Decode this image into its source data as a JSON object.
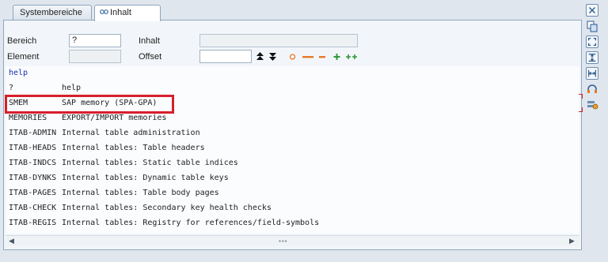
{
  "tabs": {
    "systembereiche": "Systembereiche",
    "inhalt": "Inhalt"
  },
  "form": {
    "bereich_label": "Bereich",
    "bereich_value": "?",
    "inhalt_label": "Inhalt",
    "inhalt_value": "",
    "element_label": "Element",
    "element_value": "",
    "offset_label": "Offset",
    "offset_value": ""
  },
  "output": {
    "header": "help",
    "rows": [
      {
        "key": "?",
        "desc": "help"
      },
      {
        "key": "SMEM",
        "desc": "SAP memory (SPA-GPA)"
      },
      {
        "key": "MEMORIES",
        "desc": "EXPORT/IMPORT memories"
      },
      {
        "key": "ITAB-ADMIN",
        "desc": "Internal table administration"
      },
      {
        "key": "ITAB-HEADS",
        "desc": "Internal tables: Table headers"
      },
      {
        "key": "ITAB-INDCS",
        "desc": "Internal tables: Static table indices"
      },
      {
        "key": "ITAB-DYNKS",
        "desc": "Internal tables: Dynamic table keys"
      },
      {
        "key": "ITAB-PAGES",
        "desc": "Internal tables: Table body pages"
      },
      {
        "key": "ITAB-CHECK",
        "desc": "Internal tables: Secondary key health checks"
      },
      {
        "key": "ITAB-REGIS",
        "desc": "Internal tables: Registry for references/field-symbols"
      }
    ]
  },
  "toolbar_icons": [
    "double-arrow-up-icon",
    "double-arrow-down-icon",
    "circle-icon",
    "long-minus-icon",
    "short-minus-icon",
    "plus-icon",
    "double-plus-icon"
  ],
  "right_toolbar_icons": [
    "close-icon",
    "copy-icon",
    "fullscreen-icon",
    "fit-height-icon",
    "fit-width-icon",
    "headset-icon",
    "settings-icon"
  ],
  "colors": {
    "highlight": "#d81e2c",
    "header_text": "#1a2fb0",
    "toolbar_orange": "#e8792a",
    "toolbar_green": "#2e9a3a"
  }
}
